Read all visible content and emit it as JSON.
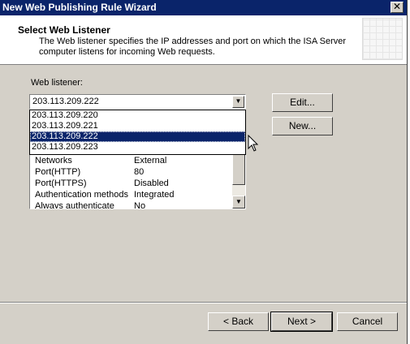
{
  "window": {
    "title": "New Web Publishing Rule Wizard",
    "close_symbol": "✕"
  },
  "header": {
    "title": "Select Web Listener",
    "description": "The Web listener specifies the IP addresses and port on which the ISA Server computer listens for incoming Web requests."
  },
  "listener": {
    "label": "Web listener:",
    "selected": "203.113.209.222",
    "options": [
      "203.113.209.220",
      "203.113.209.221",
      "203.113.209.222",
      "203.113.209.223"
    ],
    "highlighted_index": 2
  },
  "properties": [
    {
      "name": "Networks",
      "value": "External"
    },
    {
      "name": "Port(HTTP)",
      "value": "80"
    },
    {
      "name": "Port(HTTPS)",
      "value": "Disabled"
    },
    {
      "name": "Authentication methods",
      "value": "Integrated"
    },
    {
      "name": "Always authenticate",
      "value": "No"
    }
  ],
  "buttons": {
    "edit": "Edit...",
    "new": "New...",
    "back": "< Back",
    "next": "Next >",
    "cancel": "Cancel"
  }
}
